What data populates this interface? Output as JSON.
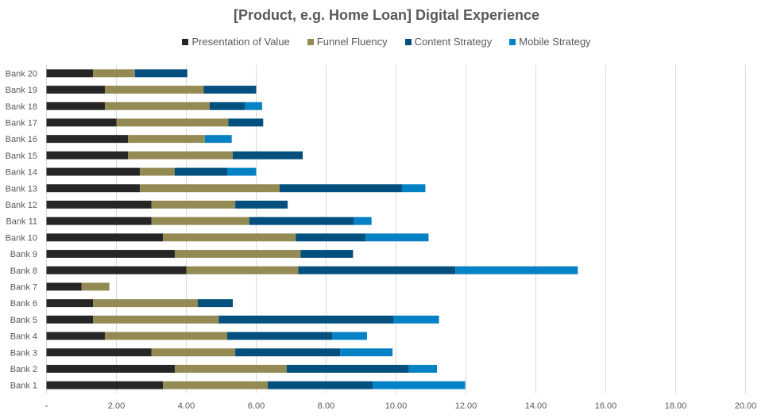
{
  "chart_data": {
    "type": "bar",
    "orientation": "horizontal",
    "stacked": true,
    "title": "[Product, e.g. Home Loan] Digital Experience",
    "xlabel": "",
    "ylabel": "",
    "xlim": [
      0,
      20
    ],
    "x_ticks": [
      0,
      2,
      4,
      6,
      8,
      10,
      12,
      14,
      16,
      18,
      20
    ],
    "x_tick_labels": [
      "-",
      "2.00",
      "4.00",
      "6.00",
      "8.00",
      "10.00",
      "12.00",
      "14.00",
      "16.00",
      "18.00",
      "20.00"
    ],
    "grid": true,
    "legend_position": "top",
    "categories": [
      "Bank 1",
      "Bank 2",
      "Bank 3",
      "Bank 4",
      "Bank 5",
      "Bank 6",
      "Bank 7",
      "Bank 8",
      "Bank 9",
      "Bank 10",
      "Bank 11",
      "Bank 12",
      "Bank 13",
      "Bank 14",
      "Bank 15",
      "Bank 16",
      "Bank 17",
      "Bank 18",
      "Bank 19",
      "Bank 20"
    ],
    "series": [
      {
        "name": "Presentation of Value",
        "color": "#262626",
        "values": [
          3.33,
          3.67,
          3.0,
          1.67,
          1.33,
          1.33,
          1.0,
          4.0,
          3.67,
          3.33,
          3.0,
          3.0,
          2.67,
          2.67,
          2.33,
          2.33,
          2.0,
          1.67,
          1.67,
          1.33
        ]
      },
      {
        "name": "Funnel Fluency",
        "color": "#948A54",
        "values": [
          3.0,
          3.2,
          2.4,
          3.5,
          3.6,
          3.0,
          0.8,
          3.2,
          3.6,
          3.8,
          2.8,
          2.4,
          4.0,
          1.0,
          3.0,
          2.2,
          3.2,
          3.0,
          2.83,
          1.2
        ]
      },
      {
        "name": "Content Strategy",
        "color": "#03507F",
        "values": [
          3.0,
          3.5,
          3.0,
          3.0,
          5.0,
          1.0,
          0,
          4.5,
          1.5,
          2.0,
          3.0,
          1.5,
          3.5,
          1.5,
          2.0,
          0,
          1.0,
          1.0,
          1.5,
          1.5
        ]
      },
      {
        "name": "Mobile Strategy",
        "color": "#0582C5",
        "values": [
          2.65,
          0.8,
          1.5,
          1.0,
          1.3,
          0,
          0,
          3.5,
          0,
          1.8,
          0.5,
          0,
          0.67,
          0.83,
          0,
          0.77,
          0,
          0.5,
          0,
          0
        ]
      }
    ]
  }
}
